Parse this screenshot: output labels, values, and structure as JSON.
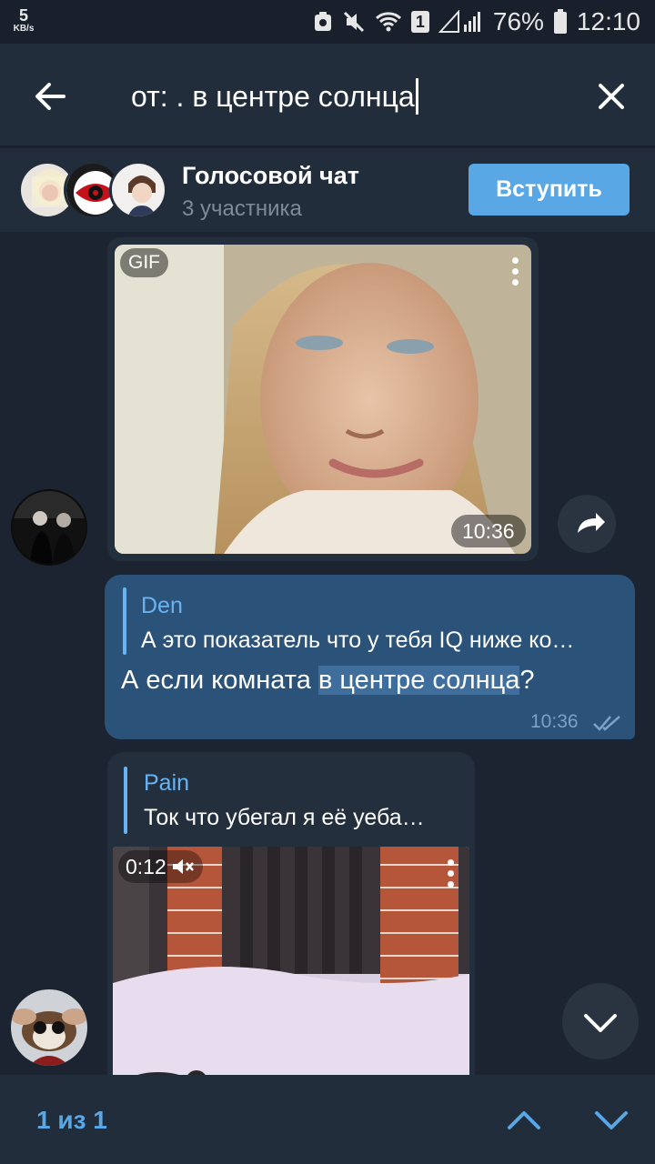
{
  "status_bar": {
    "net_speed": "5",
    "net_speed_unit": "KB/s",
    "sim_badge": "1",
    "battery": "76%",
    "time": "12:10"
  },
  "search": {
    "query": "от: . в центре солнца"
  },
  "voice_chat": {
    "title": "Голосовой чат",
    "subtitle": "3 участника",
    "join_label": "Вступить"
  },
  "messages": {
    "gif": {
      "badge": "GIF",
      "time": "10:36"
    },
    "outgoing": {
      "reply_name": "Den",
      "reply_text": "А это показатель что у тебя IQ ниже ко…",
      "text_before": "А если комната ",
      "text_match": "в центре солнца",
      "text_after": "?",
      "time": "10:36"
    },
    "incoming": {
      "reply_name": "Pain",
      "reply_text": "Ток что убегал я её уеба…",
      "video_duration": "0:12"
    }
  },
  "bottom_nav": {
    "counter": "1 из 1"
  },
  "colors": {
    "accent": "#5aa7e6",
    "header_bg": "#212d3b",
    "chat_bg": "#1b2430",
    "outgoing_bubble": "#2b5278",
    "incoming_bubble": "#242f3d",
    "link": "#6ab3f3"
  }
}
